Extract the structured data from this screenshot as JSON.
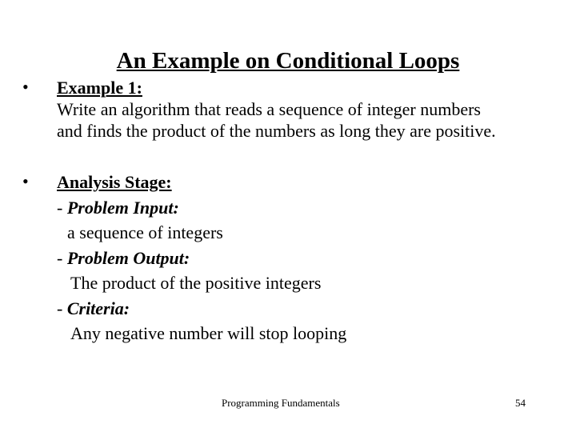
{
  "title": "An Example on Conditional Loops",
  "bullets": [
    {
      "heading": "Example 1:",
      "lines": [
        "Write an algorithm that reads a sequence of integer numbers",
        "and finds the product of the numbers as long they are positive."
      ]
    },
    {
      "heading": "Analysis Stage:",
      "items": [
        {
          "label": "Problem Input:",
          "value": "a sequence of integers"
        },
        {
          "label": "Problem Output:",
          "value": "The product of the positive integers"
        },
        {
          "label": "Criteria:",
          "value": "Any negative number will stop looping"
        }
      ]
    }
  ],
  "bullet_glyph": "•",
  "dash": "- ",
  "footer": {
    "text": "Programming Fundamentals",
    "page_number": "54"
  }
}
